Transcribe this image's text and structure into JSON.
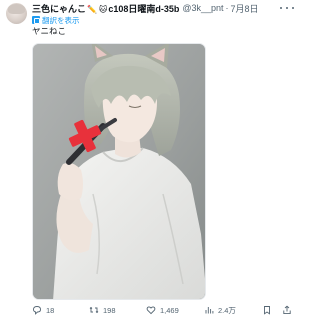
{
  "post": {
    "display_name": "三色にゃんこ",
    "emoji_1": "✏️",
    "emoji_2": "🐱",
    "name_suffix": "c108日曜南d-35b",
    "handle": "@3k__pnt",
    "separator": "·",
    "date": "7月8日",
    "translate_label": "翻訳を表示",
    "text": "ヤニねこ"
  },
  "icons": {
    "avatar": "avatar",
    "more": "more-icon",
    "translate": "translate-icon",
    "reply": "reply-icon",
    "repost": "repost-icon",
    "like": "heart-icon",
    "views": "views-icon",
    "bookmark": "bookmark-icon",
    "share": "share-icon"
  },
  "actions": {
    "reply_count": "18",
    "repost_count": "198",
    "like_count": "1,469",
    "view_count": "2.4万"
  },
  "colors": {
    "link": "#1d9bf0",
    "muted": "#536471",
    "text": "#0f1419",
    "cross": "#e8313b"
  }
}
